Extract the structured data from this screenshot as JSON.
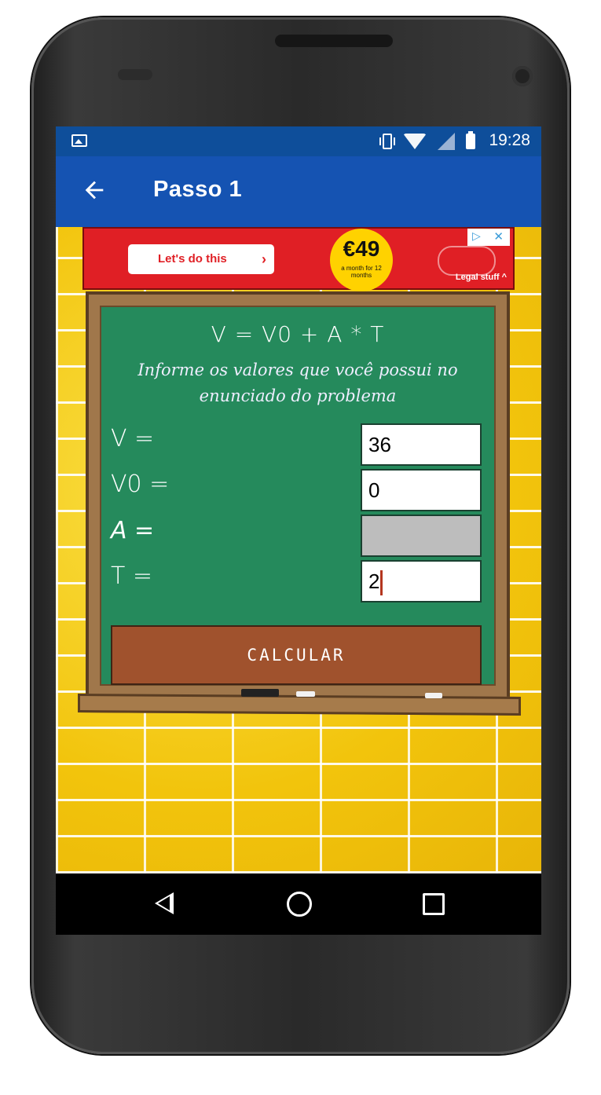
{
  "status_bar": {
    "time": "19:28",
    "icons": [
      "image-icon",
      "vibrate-icon",
      "wifi-icon",
      "no-signal-icon",
      "battery-icon"
    ]
  },
  "app_bar": {
    "title": "Passo 1",
    "back_icon": "arrow-left-icon"
  },
  "ad": {
    "cta_label": "Let's do this",
    "price": "€49",
    "price_sub": "a month for 12 months",
    "legal": "Legal stuff ^"
  },
  "board": {
    "formula": "V = V0 + A * T",
    "instructions": "Informe os valores que você possui no enunciado do problema",
    "fields": [
      {
        "label": "V =",
        "value": "36",
        "disabled": false
      },
      {
        "label": "V0 =",
        "value": "0",
        "disabled": false
      },
      {
        "label": "A =",
        "value": "",
        "disabled": true
      },
      {
        "label": "T =",
        "value": "2",
        "disabled": false
      }
    ],
    "calculate_label": "CALCULAR"
  },
  "nav_bar": {
    "icons": [
      "back-triangle-icon",
      "home-circle-icon",
      "recents-square-icon"
    ]
  },
  "colors": {
    "status_bar": "#0e4e9a",
    "app_bar": "#1553b2",
    "board": "#258a5c",
    "button": "#a0522d",
    "bricks": "#f4d21a",
    "ad": "#e01f25"
  }
}
